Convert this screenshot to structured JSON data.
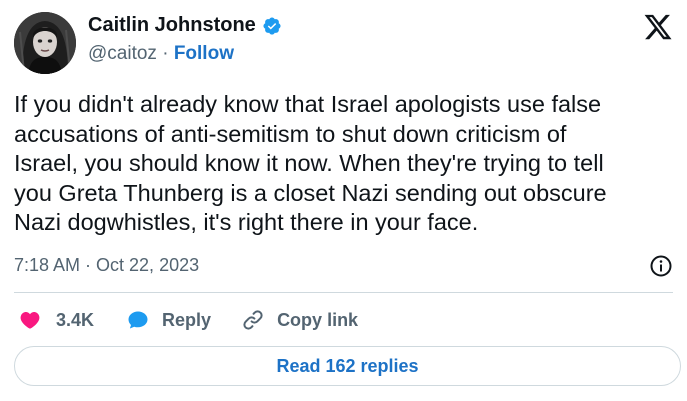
{
  "author": {
    "name": "Caitlin Johnstone",
    "handle": "@caitoz",
    "separator": " · ",
    "follow_label": "Follow",
    "verified_color": "#1d9bf0",
    "link_color": "#1d72c6"
  },
  "tweet": {
    "text": "If you didn't already know that Israel apologists use false\naccusations of anti-semitism to shut down criticism of\nIsrael, you should know it now. When they're trying to tell\nyou Greta Thunberg is a closet Nazi sending out obscure\nNazi dogwhistles, it's right there in your face.",
    "timestamp": "7:18 AM · Oct 22, 2023"
  },
  "actions": {
    "like_count": "3.4K",
    "reply_label": "Reply",
    "copy_link_label": "Copy link",
    "like_color": "#f91880",
    "reply_color": "#1d9bf0"
  },
  "footer": {
    "read_replies_label": "Read 162 replies"
  },
  "icons": [
    "avatar-image",
    "verified-badge-icon",
    "x-logo-icon",
    "info-icon",
    "heart-icon",
    "reply-bubble-icon",
    "link-icon"
  ]
}
